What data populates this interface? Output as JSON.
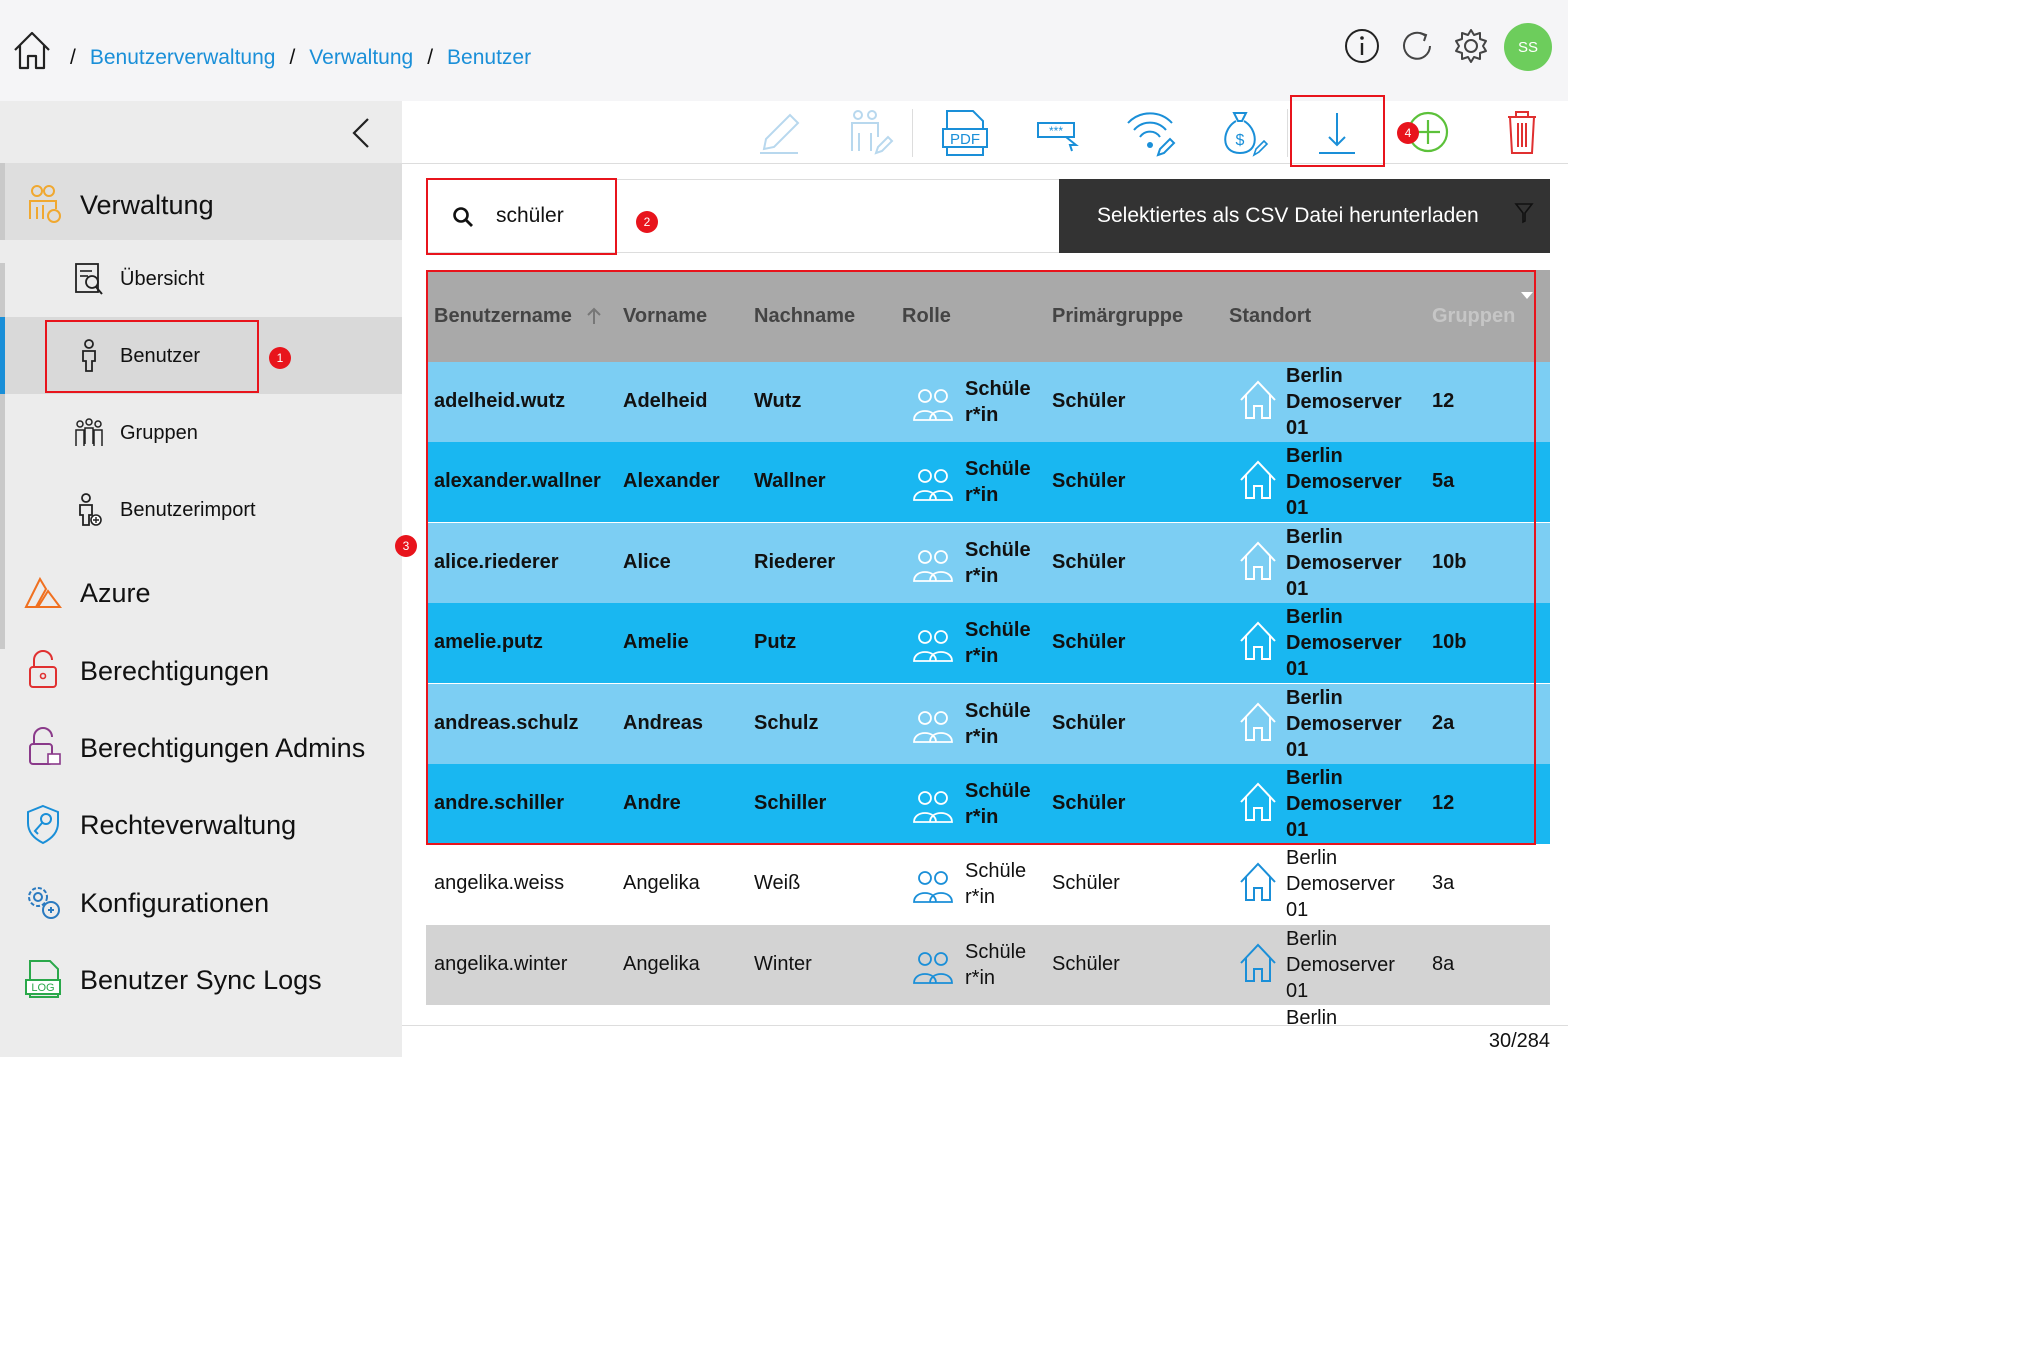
{
  "header": {
    "breadcrumbs": [
      "Benutzerverwaltung",
      "Verwaltung",
      "Benutzer"
    ],
    "separator": "/",
    "avatar_initials": "SS",
    "avatar_color": "#6dcd5c",
    "link_color": "#1a8fd8"
  },
  "sidebar": {
    "section": {
      "label": "Verwaltung",
      "icon": "users-gear-icon"
    },
    "sub_items": [
      {
        "label": "Übersicht",
        "icon": "overview-icon"
      },
      {
        "label": "Benutzer",
        "icon": "user-icon",
        "active": true
      },
      {
        "label": "Gruppen",
        "icon": "group-icon"
      },
      {
        "label": "Benutzerimport",
        "icon": "user-import-icon"
      }
    ],
    "main_items": [
      {
        "label": "Azure",
        "icon": "azure-icon"
      },
      {
        "label": "Berechtigungen",
        "icon": "lock-icon"
      },
      {
        "label": "Berechtigungen Admins",
        "icon": "admin-lock-icon"
      },
      {
        "label": "Rechteverwaltung",
        "icon": "shield-key-icon"
      },
      {
        "label": "Konfigurationen",
        "icon": "gears-icon"
      },
      {
        "label": "Benutzer Sync Logs",
        "icon": "log-icon"
      }
    ]
  },
  "toolbar": {
    "buttons": [
      "edit-icon",
      "group-edit-icon",
      "pdf-icon",
      "password-icon",
      "wifi-edit-icon",
      "money-bag-icon",
      "download-icon",
      "add-icon",
      "delete-icon"
    ]
  },
  "search": {
    "value": "schüler"
  },
  "csv_banner": {
    "text": "Selektiertes als CSV Datei herunterladen"
  },
  "table": {
    "columns": [
      "Benutzername",
      "Vorname",
      "Nachname",
      "Rolle",
      "Primärgruppe",
      "Standort",
      "Gruppen"
    ],
    "rows": [
      {
        "user": "adelheid.wutz",
        "first": "Adelheid",
        "last": "Wutz",
        "role": [
          "Schüle",
          "r*in"
        ],
        "primary": "Schüler",
        "site": [
          "Berlin",
          "Demoserver",
          "01"
        ],
        "groups": "12",
        "selected": true
      },
      {
        "user": "alexander.wallner",
        "first": "Alexander",
        "last": "Wallner",
        "role": [
          "Schüle",
          "r*in"
        ],
        "primary": "Schüler",
        "site": [
          "Berlin",
          "Demoserver",
          "01"
        ],
        "groups": "5a",
        "selected": true
      },
      {
        "user": "alice.riederer",
        "first": "Alice",
        "last": "Riederer",
        "role": [
          "Schüle",
          "r*in"
        ],
        "primary": "Schüler",
        "site": [
          "Berlin",
          "Demoserver",
          "01"
        ],
        "groups": "10b",
        "selected": true
      },
      {
        "user": "amelie.putz",
        "first": "Amelie",
        "last": "Putz",
        "role": [
          "Schüle",
          "r*in"
        ],
        "primary": "Schüler",
        "site": [
          "Berlin",
          "Demoserver",
          "01"
        ],
        "groups": "10b",
        "selected": true
      },
      {
        "user": "andreas.schulz",
        "first": "Andreas",
        "last": "Schulz",
        "role": [
          "Schüle",
          "r*in"
        ],
        "primary": "Schüler",
        "site": [
          "Berlin",
          "Demoserver",
          "01"
        ],
        "groups": "2a",
        "selected": true
      },
      {
        "user": "andre.schiller",
        "first": "Andre",
        "last": "Schiller",
        "role": [
          "Schüle",
          "r*in"
        ],
        "primary": "Schüler",
        "site": [
          "Berlin",
          "Demoserver",
          "01"
        ],
        "groups": "12",
        "selected": true
      },
      {
        "user": "angelika.weiss",
        "first": "Angelika",
        "last": "Weiß",
        "role": [
          "Schüle",
          "r*in"
        ],
        "primary": "Schüler",
        "site": [
          "Berlin",
          "Demoserver",
          "01"
        ],
        "groups": "3a",
        "selected": false
      },
      {
        "user": "angelika.winter",
        "first": "Angelika",
        "last": "Winter",
        "role": [
          "Schüle",
          "r*in"
        ],
        "primary": "Schüler",
        "site": [
          "Berlin",
          "Demoserver",
          "01"
        ],
        "groups": "8a",
        "selected": false
      }
    ],
    "partial_row": {
      "site_top": "Berlin"
    }
  },
  "footer": {
    "count": "30/284"
  },
  "annotations": [
    "1",
    "2",
    "3",
    "4"
  ]
}
